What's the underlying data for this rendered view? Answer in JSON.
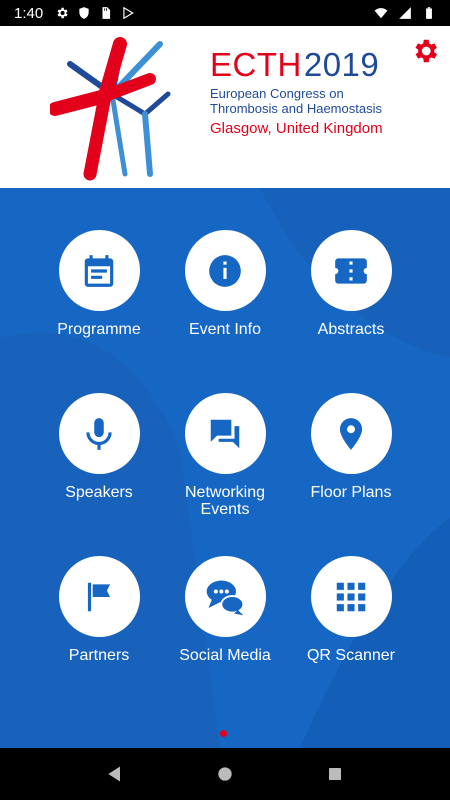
{
  "status_bar": {
    "time": "1:40",
    "left_icons": [
      "gear-icon",
      "shield-icon",
      "sd-card-icon",
      "play-store-icon"
    ],
    "right_icons": [
      "wifi-icon",
      "signal-icon",
      "battery-icon"
    ]
  },
  "header": {
    "logo_ecth": "ECTH",
    "logo_year": "2019",
    "logo_line1": "European Congress on",
    "logo_line2": "Thrombosis and Haemostasis",
    "logo_place": "Glasgow, United Kingdom",
    "settings_icon": "gear-icon"
  },
  "tiles": [
    {
      "label": "Programme",
      "icon": "calendar-icon"
    },
    {
      "label": "Event Info",
      "icon": "info-icon"
    },
    {
      "label": "Abstracts",
      "icon": "ticket-icon"
    },
    {
      "label": "Speakers",
      "icon": "microphone-icon"
    },
    {
      "label": "Networking Events",
      "icon": "chat-icon"
    },
    {
      "label": "Floor Plans",
      "icon": "location-pin-icon"
    },
    {
      "label": "Partners",
      "icon": "flag-icon"
    },
    {
      "label": "Social Media",
      "icon": "speech-bubbles-icon"
    },
    {
      "label": "QR Scanner",
      "icon": "grid-icon"
    }
  ],
  "pager": {
    "active_page": 1
  },
  "colors": {
    "brand_blue": "#1666c4",
    "brand_red": "#e3001b",
    "logo_blue": "#1f4a99"
  },
  "nav_bar": [
    "back-icon",
    "home-icon",
    "recents-icon"
  ]
}
